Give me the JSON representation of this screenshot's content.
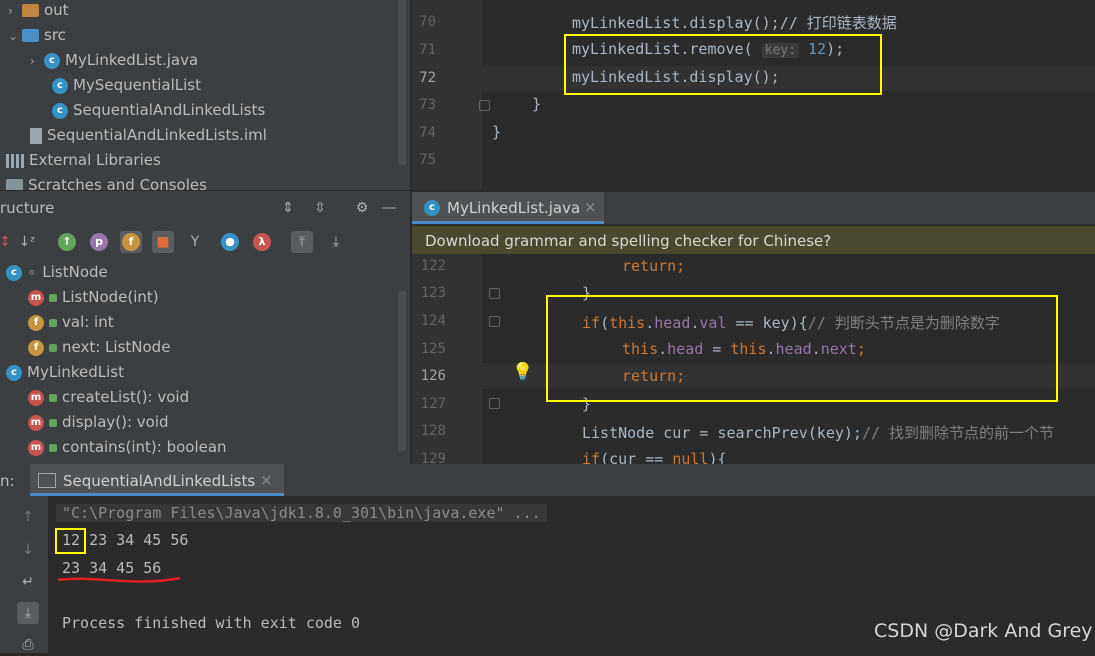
{
  "project_tree": {
    "items": [
      {
        "label": "out",
        "arrow": "›"
      },
      {
        "label": "src",
        "arrow": "⌄"
      },
      {
        "label": "MyLinkedList.java",
        "arrow": "›"
      },
      {
        "label": "MySequentialList"
      },
      {
        "label": "SequentialAndLinkedLists"
      },
      {
        "label": "SequentialAndLinkedLists.iml"
      },
      {
        "label": "External Libraries"
      },
      {
        "label": "Scratches and Consoles"
      }
    ]
  },
  "structure": {
    "title": "ructure",
    "icon_letters": [
      "p",
      "f",
      "λ"
    ],
    "items": [
      {
        "label": "ListNode"
      },
      {
        "label": "ListNode(int)",
        "icon": "m"
      },
      {
        "label": "val: int",
        "icon": "f"
      },
      {
        "label": "next: ListNode",
        "icon": "f"
      },
      {
        "label": "MyLinkedList"
      },
      {
        "label": "createList(): void",
        "icon": "m"
      },
      {
        "label": "display(): void",
        "icon": "m"
      },
      {
        "label": "contains(int): boolean",
        "icon": "m"
      }
    ]
  },
  "editor_top": {
    "lines": [
      {
        "n": "70",
        "code": "myLinkedList.display();// 打印链表数据"
      },
      {
        "n": "71",
        "code_a": "myLinkedList.remove( ",
        "hint": "key:",
        "code_num": "12",
        "code_b": ");"
      },
      {
        "n": "72",
        "code": "myLinkedList.display();"
      },
      {
        "n": "73",
        "code": "}"
      },
      {
        "n": "74",
        "code": "}"
      },
      {
        "n": "75",
        "code": ""
      }
    ]
  },
  "tab": {
    "label": "MyLinkedList.java",
    "close": "×",
    "icon_letter": "c"
  },
  "banner": {
    "text": "Download grammar and spelling checker for Chinese?"
  },
  "editor_bottom": {
    "lines": [
      {
        "n": "122",
        "code": "return;"
      },
      {
        "n": "123",
        "code": "}"
      },
      {
        "n": "124",
        "kw_if": "if",
        "code_a": "(",
        "kw_this": "this",
        "dot1": ".",
        "fld1": "head",
        "dot2": ".",
        "fld2": "val",
        "code_b": " == key){",
        "comment": "// 判断头节点是为删除数字"
      },
      {
        "n": "125",
        "kw_this1": "this",
        "dot1": ".",
        "fld1": "head",
        "code_a": " = ",
        "kw_this2": "this",
        "dot2": ".",
        "fld2": "head",
        "dot3": ".",
        "fld3": "next",
        "code_b": ";"
      },
      {
        "n": "126",
        "code": "return;"
      },
      {
        "n": "127",
        "code": "}"
      },
      {
        "n": "128",
        "code_a": "ListNode cur = searchPrev(key);",
        "comment": "// 找到删除节点的前一个节"
      },
      {
        "n": "129",
        "kw_if": "if",
        "code_a": "(cur == ",
        "kw_null": "null",
        "code_b": "){"
      }
    ]
  },
  "run": {
    "prefix": "n:",
    "tab_label": "SequentialAndLinkedLists",
    "close": "×",
    "command": "\"C:\\Program Files\\Java\\jdk1.8.0_301\\bin\\java.exe\" ...",
    "output_first": "12",
    "output_rest": " 23 34 45 56",
    "output_line2": "23 34 45 56",
    "blank": "",
    "exit": "Process finished with exit code 0"
  },
  "watermark": "CSDN @Dark And Grey",
  "colors": {
    "highlight_box": "#ffff00",
    "underline": "#e02020",
    "accent": "#4a88c7"
  }
}
